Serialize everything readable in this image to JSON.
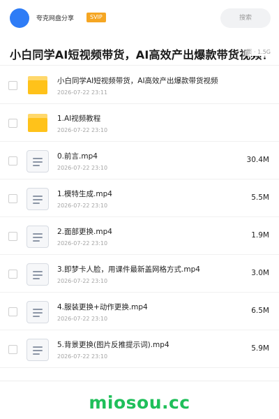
{
  "header": {
    "owner_name": "夸克网盘分享",
    "badge": "SVIP",
    "search_label": "搜索"
  },
  "share": {
    "title": "小白同学AI短视频带货，AI高效产出爆款带货视频！",
    "meta": "页 · 1.5G"
  },
  "files": [
    {
      "type": "folder",
      "name": "小白同学AI短视频带货，AI高效产出爆款带货视频",
      "date": "2026-07-22 23:11",
      "size": ""
    },
    {
      "type": "folder",
      "name": "1.AI视频教程",
      "date": "2026-07-22 23:10",
      "size": ""
    },
    {
      "type": "file",
      "name": "0.前言.mp4",
      "date": "2026-07-22 23:10",
      "size": "30.4M"
    },
    {
      "type": "file",
      "name": "1.模特生成.mp4",
      "date": "2026-07-22 23:10",
      "size": "5.5M"
    },
    {
      "type": "file",
      "name": "2.面部更换.mp4",
      "date": "2026-07-22 23:10",
      "size": "1.9M"
    },
    {
      "type": "file",
      "name": "3.即梦卡人脸，用课件最新盖网格方式.mp4",
      "date": "2026-07-22 23:10",
      "size": "3.0M"
    },
    {
      "type": "file",
      "name": "4.服装更换+动作更换.mp4",
      "date": "2026-07-22 23:10",
      "size": "6.5M"
    },
    {
      "type": "file",
      "name": "5.背景更换(图片反推提示词).mp4",
      "date": "2026-07-22 23:10",
      "size": "5.9M"
    }
  ],
  "watermark": "miosou.cc",
  "colors": {
    "accent": "#2e7cf6",
    "badge": "#f5a623",
    "folder": "#ffc21a",
    "watermark": "#1fbf5a"
  }
}
